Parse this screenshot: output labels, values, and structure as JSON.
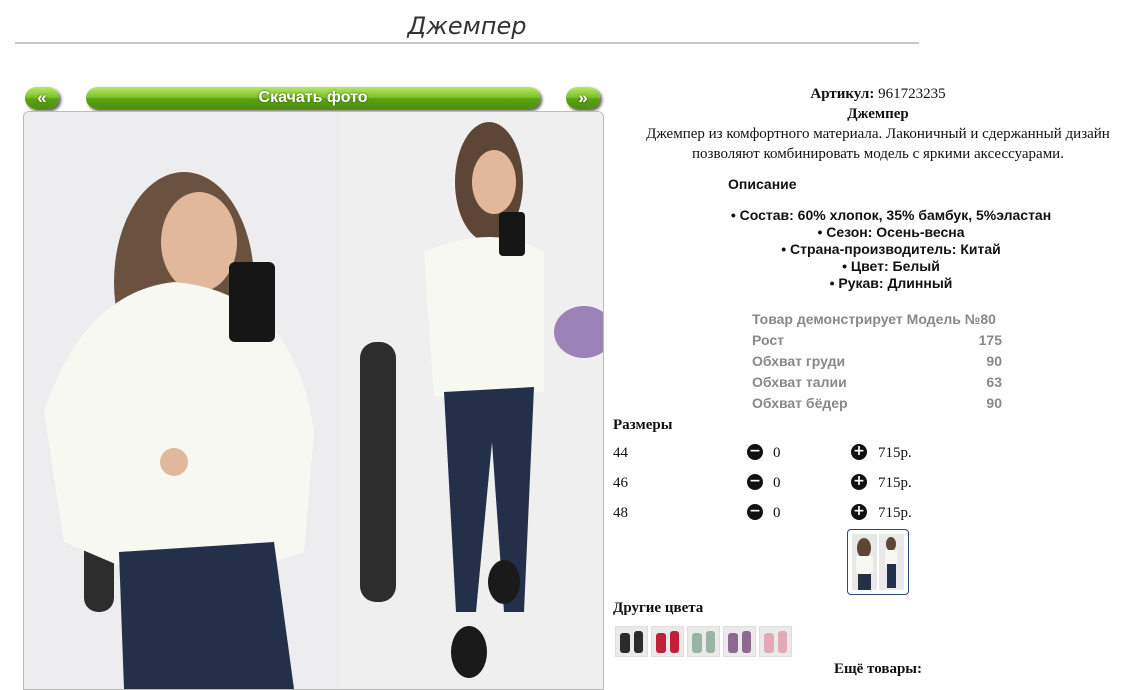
{
  "page": {
    "title": "Джемпер"
  },
  "gallery": {
    "prev_label": "«",
    "next_label": "»",
    "download_label": "Скачать фото"
  },
  "product": {
    "article_label": "Артикул:",
    "article_value": "961723235",
    "name": "Джемпер",
    "description_line1": "Джемпер из комфортного материала. Лаконичный и сдержанный дизайн",
    "description_line2": "позволяют комбинировать модель с яркими аксессуарами.",
    "desc_heading": "Описание",
    "features": [
      "• Состав: 60% хлопок, 35% бамбук, 5%эластан",
      "• Сезон: Осень-весна",
      "• Страна-производитель: Китай",
      "• Цвет: Белый",
      "• Рукав: Длинный"
    ],
    "model_params": [
      {
        "label": "Товар демонстрирует Модель №80",
        "value": ""
      },
      {
        "label": "Рост",
        "value": "175"
      },
      {
        "label": "Обхват груди",
        "value": "90"
      },
      {
        "label": "Обхват талии",
        "value": "63"
      },
      {
        "label": "Обхват бёдер",
        "value": "90"
      }
    ]
  },
  "sizes": {
    "heading": "Размеры",
    "minus_icon": "minus-circle-icon",
    "plus_icon": "plus-circle-icon",
    "rows": [
      {
        "size": "44",
        "qty": "0",
        "price": "715р."
      },
      {
        "size": "46",
        "qty": "0",
        "price": "715р."
      },
      {
        "size": "48",
        "qty": "0",
        "price": "715р."
      }
    ]
  },
  "other_colors": {
    "heading": "Другие цвета",
    "swatch_colors": [
      "#2b2b2b",
      "#c21f3a",
      "#9bb3a4",
      "#8c6a8f",
      "#e4a9b6"
    ]
  },
  "more": {
    "heading": "Ещё товары:"
  },
  "colors": {
    "button_green": "#5aa214",
    "text": "#111111",
    "param_gray": "#888888",
    "divider": "#c8c8c8"
  }
}
